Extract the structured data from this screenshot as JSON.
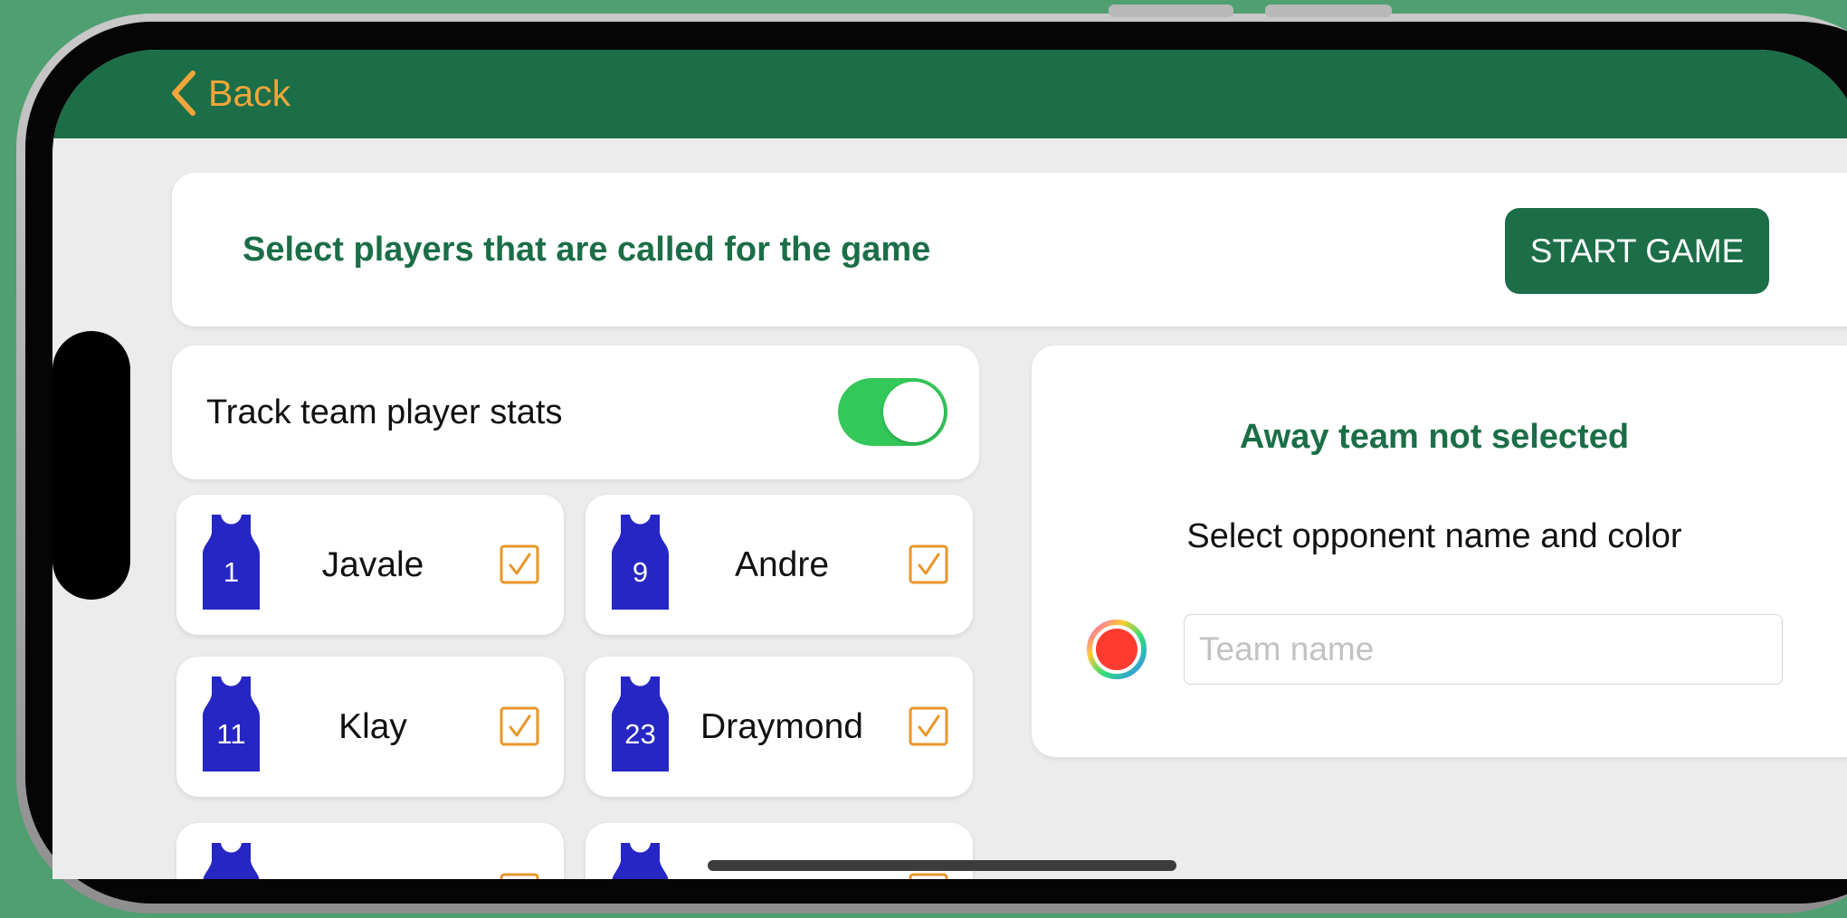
{
  "nav": {
    "back_label": "Back"
  },
  "header": {
    "title": "Select players that are called for the game",
    "start_button": "START GAME"
  },
  "track": {
    "label": "Track team player stats",
    "enabled": true
  },
  "players": [
    {
      "number": "1",
      "name": "Javale",
      "checked": true
    },
    {
      "number": "9",
      "name": "Andre",
      "checked": true
    },
    {
      "number": "11",
      "name": "Klay",
      "checked": true
    },
    {
      "number": "23",
      "name": "Draymond",
      "checked": true
    }
  ],
  "away": {
    "title": "Away team not selected",
    "subtitle": "Select opponent name and color",
    "team_name_placeholder": "Team name",
    "team_name_value": "",
    "selected_color": "#ff3b30"
  },
  "colors": {
    "nav_green": "#1b6e47",
    "accent_orange": "#f0a53a",
    "toggle_green": "#34c759",
    "jersey_blue": "#2626c4",
    "checkbox_orange": "#e8962a"
  },
  "icons": {
    "back": "chevron-left-icon",
    "jersey": "jersey-icon",
    "checkbox": "checkbox-checked-icon",
    "color_picker": "color-wheel-icon"
  }
}
